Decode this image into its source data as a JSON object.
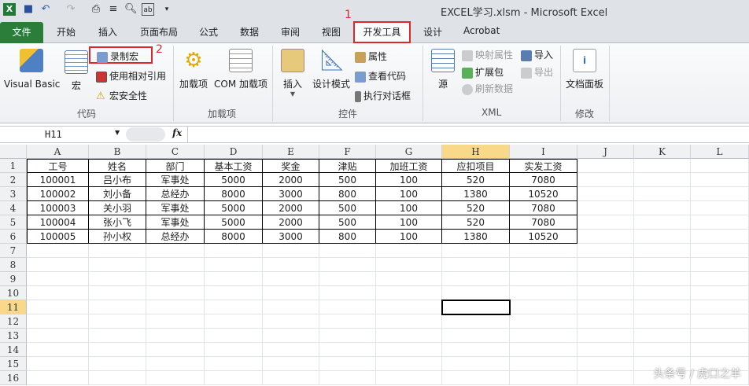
{
  "window": {
    "title": "EXCEL学习.xlsm  -  Microsoft Excel"
  },
  "quick_access": [
    "excel-logo-icon",
    "save-icon",
    "undo-icon",
    "redo-icon",
    "print-preview-icon",
    "align-icon",
    "zoom-doc-icon",
    "form-icon",
    "customize-icon"
  ],
  "tabs": [
    "文件",
    "开始",
    "插入",
    "页面布局",
    "公式",
    "数据",
    "审阅",
    "视图",
    "开发工具",
    "设计",
    "Acrobat"
  ],
  "active_tab": "开发工具",
  "annotations": {
    "step1": "1",
    "step2": "2"
  },
  "ribbon": {
    "code": {
      "label": "代码",
      "visual_basic": "Visual Basic",
      "macros": "宏",
      "record_macro": "录制宏",
      "relative_ref": "使用相对引用",
      "macro_security": "宏安全性"
    },
    "addins": {
      "label": "加载项",
      "addins": "加载项",
      "com_addins": "COM 加载项"
    },
    "controls": {
      "label": "控件",
      "insert": "插入",
      "design_mode": "设计模式",
      "properties": "属性",
      "view_code": "查看代码",
      "run_dialog": "执行对话框"
    },
    "xml": {
      "label": "XML",
      "source": "源",
      "map_props": "映射属性",
      "expansion": "扩展包",
      "refresh": "刷新数据",
      "import": "导入",
      "export": "导出"
    },
    "modify": {
      "label": "修改",
      "doc_panel": "文档面板"
    }
  },
  "formula_bar": {
    "name_box": "H11",
    "fx": "fx",
    "formula": ""
  },
  "sheet": {
    "columns": [
      "A",
      "B",
      "C",
      "D",
      "E",
      "F",
      "G",
      "H",
      "I",
      "J",
      "K",
      "L"
    ],
    "rows": [
      "1",
      "2",
      "3",
      "4",
      "5",
      "6",
      "7",
      "8",
      "9",
      "10",
      "11",
      "12",
      "13",
      "14",
      "15",
      "16"
    ],
    "selected_cell": "H11",
    "headers": [
      "工号",
      "姓名",
      "部门",
      "基本工资",
      "奖金",
      "津贴",
      "加班工资",
      "应扣项目",
      "实发工资"
    ],
    "data": [
      [
        "100001",
        "吕小布",
        "军事处",
        "5000",
        "2000",
        "500",
        "100",
        "520",
        "7080"
      ],
      [
        "100002",
        "刘小备",
        "总经办",
        "8000",
        "3000",
        "800",
        "100",
        "1380",
        "10520"
      ],
      [
        "100003",
        "关小羽",
        "军事处",
        "5000",
        "2000",
        "500",
        "100",
        "520",
        "7080"
      ],
      [
        "100004",
        "张小飞",
        "军事处",
        "5000",
        "2000",
        "500",
        "100",
        "520",
        "7080"
      ],
      [
        "100005",
        "孙小权",
        "总经办",
        "8000",
        "3000",
        "800",
        "100",
        "1380",
        "10520"
      ]
    ]
  },
  "watermark": "头条号 / 虎口之羊"
}
